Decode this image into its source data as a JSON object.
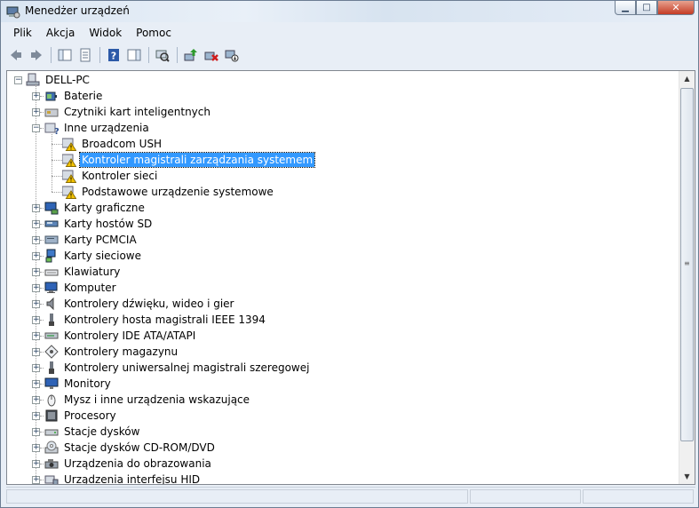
{
  "window": {
    "title": "Menedżer urządzeń"
  },
  "menu": [
    "Plik",
    "Akcja",
    "Widok",
    "Pomoc"
  ],
  "toolbar": {
    "buttons": [
      "back-icon",
      "forward-icon",
      "sep",
      "console-tree-icon",
      "properties-icon",
      "sep",
      "help-icon",
      "action-pane-icon",
      "sep",
      "scan-hardware-icon",
      "sep",
      "update-driver-icon",
      "uninstall-icon",
      "disable-icon"
    ]
  },
  "tree": {
    "root": "DELL-PC",
    "items": [
      {
        "label": "Baterie",
        "icon": "battery-icon",
        "level": 1,
        "expanded": false
      },
      {
        "label": "Czytniki kart inteligentnych",
        "icon": "smartcard-icon",
        "level": 1,
        "expanded": false
      },
      {
        "label": "Inne urządzenia",
        "icon": "unknown-device-icon",
        "level": 1,
        "expanded": true
      },
      {
        "label": "Broadcom USH",
        "icon": "warning-device-icon",
        "level": 2
      },
      {
        "label": "Kontroler magistrali zarządzania systemem",
        "icon": "warning-device-icon",
        "level": 2,
        "selected": true
      },
      {
        "label": "Kontroler sieci",
        "icon": "warning-device-icon",
        "level": 2
      },
      {
        "label": "Podstawowe urządzenie systemowe",
        "icon": "warning-device-icon",
        "level": 2
      },
      {
        "label": "Karty graficzne",
        "icon": "display-adapter-icon",
        "level": 1,
        "expanded": false
      },
      {
        "label": "Karty hostów SD",
        "icon": "sd-host-icon",
        "level": 1,
        "expanded": false
      },
      {
        "label": "Karty PCMCIA",
        "icon": "pcmcia-icon",
        "level": 1,
        "expanded": false
      },
      {
        "label": "Karty sieciowe",
        "icon": "network-adapter-icon",
        "level": 1,
        "expanded": false
      },
      {
        "label": "Klawiatury",
        "icon": "keyboard-icon",
        "level": 1,
        "expanded": false
      },
      {
        "label": "Komputer",
        "icon": "computer-icon",
        "level": 1,
        "expanded": false
      },
      {
        "label": "Kontrolery dźwięku, wideo i gier",
        "icon": "speaker-icon",
        "level": 1,
        "expanded": false
      },
      {
        "label": "Kontrolery hosta magistrali IEEE 1394",
        "icon": "firewire-icon",
        "level": 1,
        "expanded": false
      },
      {
        "label": "Kontrolery IDE ATA/ATAPI",
        "icon": "ide-icon",
        "level": 1,
        "expanded": false
      },
      {
        "label": "Kontrolery magazynu",
        "icon": "storage-controller-icon",
        "level": 1,
        "expanded": false
      },
      {
        "label": "Kontrolery uniwersalnej magistrali szeregowej",
        "icon": "usb-icon",
        "level": 1,
        "expanded": false
      },
      {
        "label": "Monitory",
        "icon": "monitor-icon",
        "level": 1,
        "expanded": false
      },
      {
        "label": "Mysz i inne urządzenia wskazujące",
        "icon": "mouse-icon",
        "level": 1,
        "expanded": false
      },
      {
        "label": "Procesory",
        "icon": "processor-icon",
        "level": 1,
        "expanded": false
      },
      {
        "label": "Stacje dysków",
        "icon": "disk-drive-icon",
        "level": 1,
        "expanded": false
      },
      {
        "label": "Stacje dysków CD-ROM/DVD",
        "icon": "cdrom-icon",
        "level": 1,
        "expanded": false
      },
      {
        "label": "Urządzenia do obrazowania",
        "icon": "imaging-icon",
        "level": 1,
        "expanded": false
      },
      {
        "label": "Urządzenia interfejsu HID",
        "icon": "hid-icon",
        "level": 1,
        "expanded": false
      }
    ]
  },
  "colors": {
    "selection": "#3399ff",
    "warning": "#f5c400",
    "titlebar": "#dbe6f3"
  }
}
